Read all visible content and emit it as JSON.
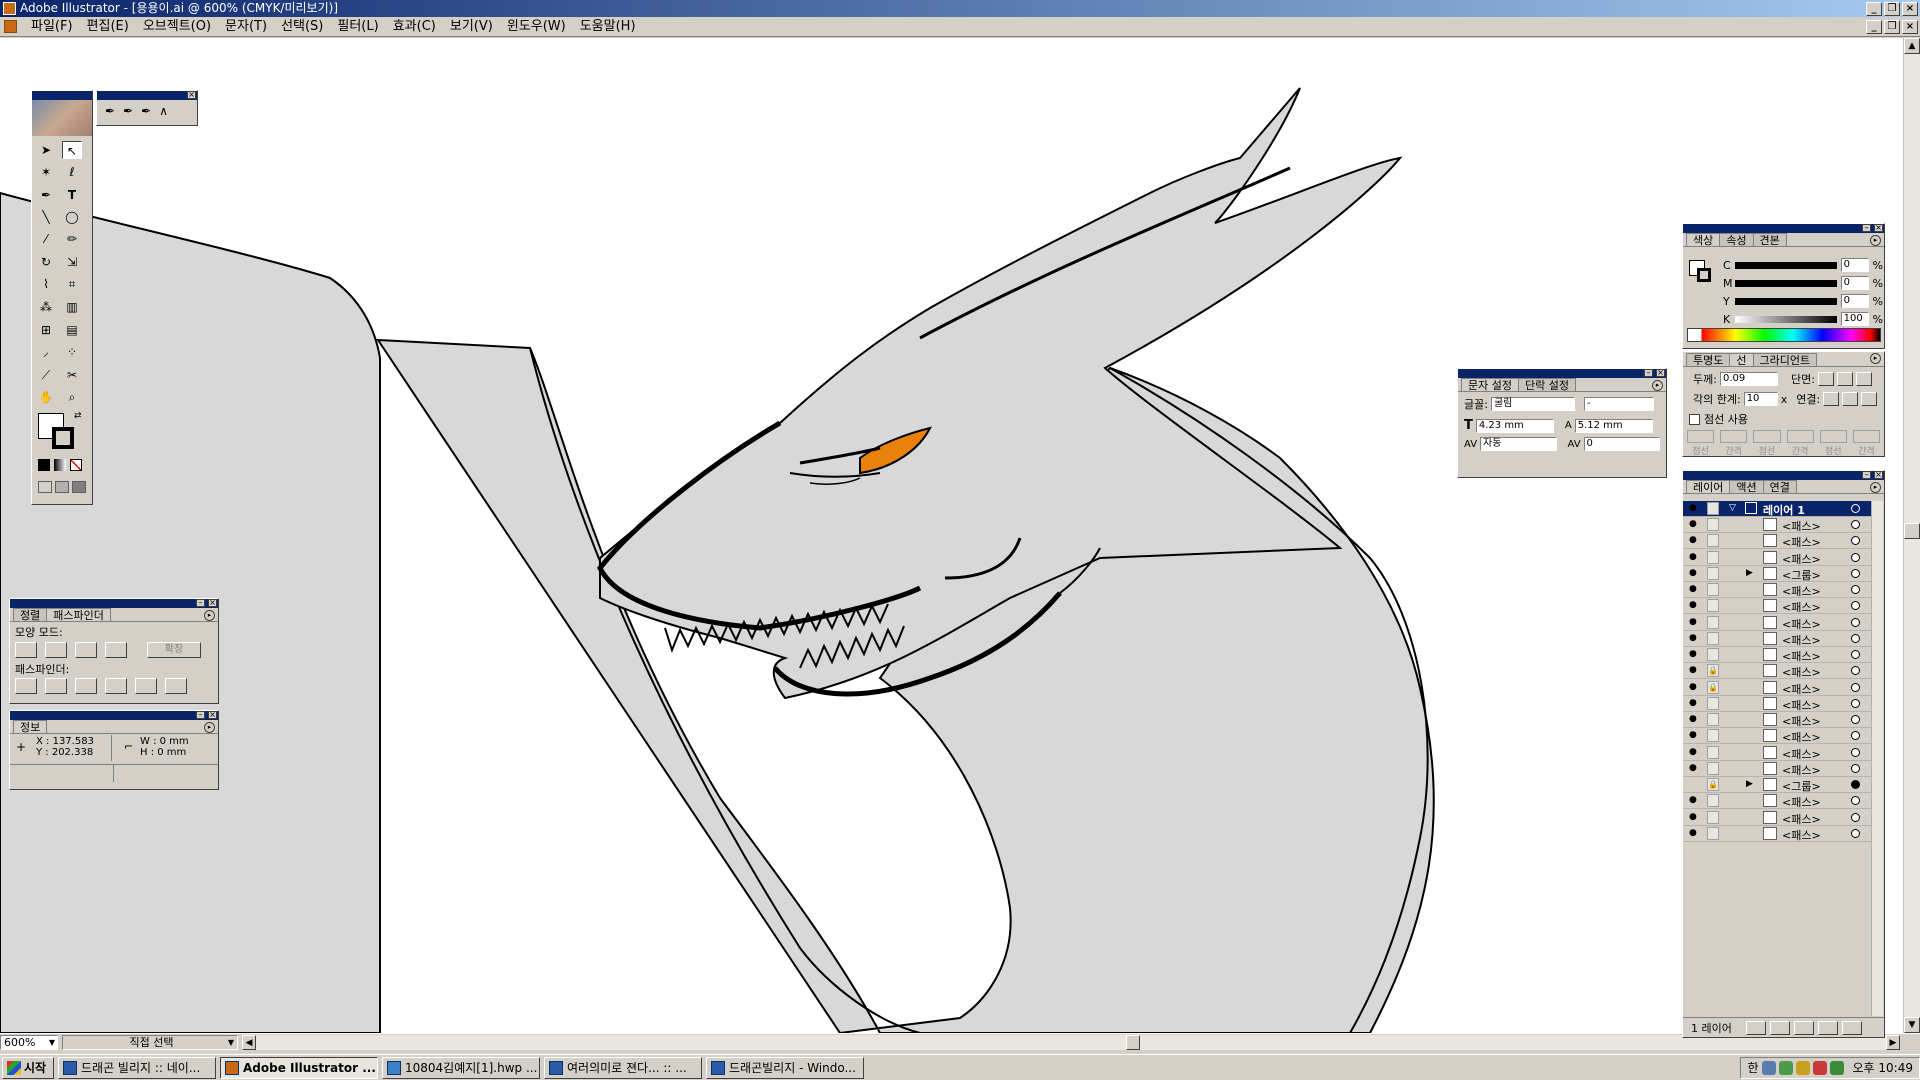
{
  "window": {
    "title": "Adobe Illustrator - [용용이.ai @ 600% (CMYK/미리보기)]"
  },
  "menus": [
    "파일(F)",
    "편집(E)",
    "오브젝트(O)",
    "문자(T)",
    "선택(S)",
    "필터(L)",
    "효과(C)",
    "보기(V)",
    "윈도우(W)",
    "도움말(H)"
  ],
  "status": {
    "zoom": "600%",
    "tool": "직접 선택"
  },
  "taskbar": {
    "start": "시작",
    "clock": "오후 10:49",
    "ime": "한",
    "tasks": [
      {
        "label": "드래곤 빌리지 :: 네이...",
        "active": false
      },
      {
        "label": "Adobe Illustrator ...",
        "active": true
      },
      {
        "label": "10804김예지[1].hwp ...",
        "active": false
      },
      {
        "label": "여러의미로 젼다... :: ...",
        "active": false
      },
      {
        "label": "드래곤빌리지 - Windo...",
        "active": false
      }
    ]
  },
  "pathfinder": {
    "tabs": [
      "정렬",
      "패스파인더"
    ],
    "shape_modes": "모양 모드:",
    "expand": "확장",
    "pathfinder_label": "패스파인더:"
  },
  "info": {
    "tab": "정보",
    "x": "X : 137.583",
    "y": "Y : 202.338",
    "w": "W : 0 mm",
    "h": "H : 0 mm"
  },
  "color": {
    "tabs": [
      "색상",
      "속성",
      "견본"
    ],
    "channels": [
      {
        "label": "C",
        "value": "0",
        "unit": "%"
      },
      {
        "label": "M",
        "value": "0",
        "unit": "%"
      },
      {
        "label": "Y",
        "value": "0",
        "unit": "%"
      },
      {
        "label": "K",
        "value": "100",
        "unit": "%"
      }
    ]
  },
  "stroke": {
    "tabs": [
      "투명도",
      "선",
      "그라디언트"
    ],
    "weight_label": "두께:",
    "weight": "0.09",
    "cap_label": "단면:",
    "miter_label": "각의 한계:",
    "miter": "10",
    "miter_unit": "x",
    "join_label": "연결:",
    "dashed_label": "점선 사용",
    "dash_labels": [
      "점선",
      "간격",
      "점선",
      "간격",
      "점선",
      "간격"
    ]
  },
  "character": {
    "tabs": [
      "문자 설정",
      "단락 설정"
    ],
    "font_label": "글꼴:",
    "font": "굴림",
    "style": "-",
    "size": "4.23 mm",
    "leading": "5.12 mm",
    "kerning": "자동",
    "tracking": "0"
  },
  "layers": {
    "tabs": [
      "레이어",
      "액션",
      "연결"
    ],
    "footer": "1 레이어",
    "layer_name": "레이어 1",
    "rows": [
      {
        "name": "<패스>",
        "lock": false,
        "expand": false,
        "vis": true,
        "target": false
      },
      {
        "name": "<패스>",
        "lock": false,
        "expand": false,
        "vis": true,
        "target": false
      },
      {
        "name": "<패스>",
        "lock": false,
        "expand": false,
        "vis": true,
        "target": false
      },
      {
        "name": "<그룹>",
        "lock": false,
        "expand": true,
        "vis": true,
        "target": false
      },
      {
        "name": "<패스>",
        "lock": false,
        "expand": false,
        "vis": true,
        "target": false
      },
      {
        "name": "<패스>",
        "lock": false,
        "expand": false,
        "vis": true,
        "target": false
      },
      {
        "name": "<패스>",
        "lock": false,
        "expand": false,
        "vis": true,
        "target": false
      },
      {
        "name": "<패스>",
        "lock": false,
        "expand": false,
        "vis": true,
        "target": false
      },
      {
        "name": "<패스>",
        "lock": false,
        "expand": false,
        "vis": true,
        "target": false
      },
      {
        "name": "<패스>",
        "lock": true,
        "expand": false,
        "vis": true,
        "target": false
      },
      {
        "name": "<패스>",
        "lock": true,
        "expand": false,
        "vis": true,
        "target": false
      },
      {
        "name": "<패스>",
        "lock": false,
        "expand": false,
        "vis": true,
        "target": false
      },
      {
        "name": "<패스>",
        "lock": false,
        "expand": false,
        "vis": true,
        "target": false
      },
      {
        "name": "<패스>",
        "lock": false,
        "expand": false,
        "vis": true,
        "target": false
      },
      {
        "name": "<패스>",
        "lock": false,
        "expand": false,
        "vis": true,
        "target": false
      },
      {
        "name": "<패스>",
        "lock": false,
        "expand": false,
        "vis": true,
        "target": false
      },
      {
        "name": "<그룹>",
        "lock": true,
        "expand": true,
        "vis": false,
        "target": true
      },
      {
        "name": "<패스>",
        "lock": false,
        "expand": false,
        "vis": true,
        "target": false
      },
      {
        "name": "<패스>",
        "lock": false,
        "expand": false,
        "vis": true,
        "target": false
      },
      {
        "name": "<패스>",
        "lock": false,
        "expand": false,
        "vis": true,
        "target": false
      }
    ]
  },
  "colors": {
    "title_blue": "#0a246a",
    "chrome": "#d4d0c8",
    "artwork_fill": "#d8d8d8",
    "eye": "#e8820a"
  }
}
